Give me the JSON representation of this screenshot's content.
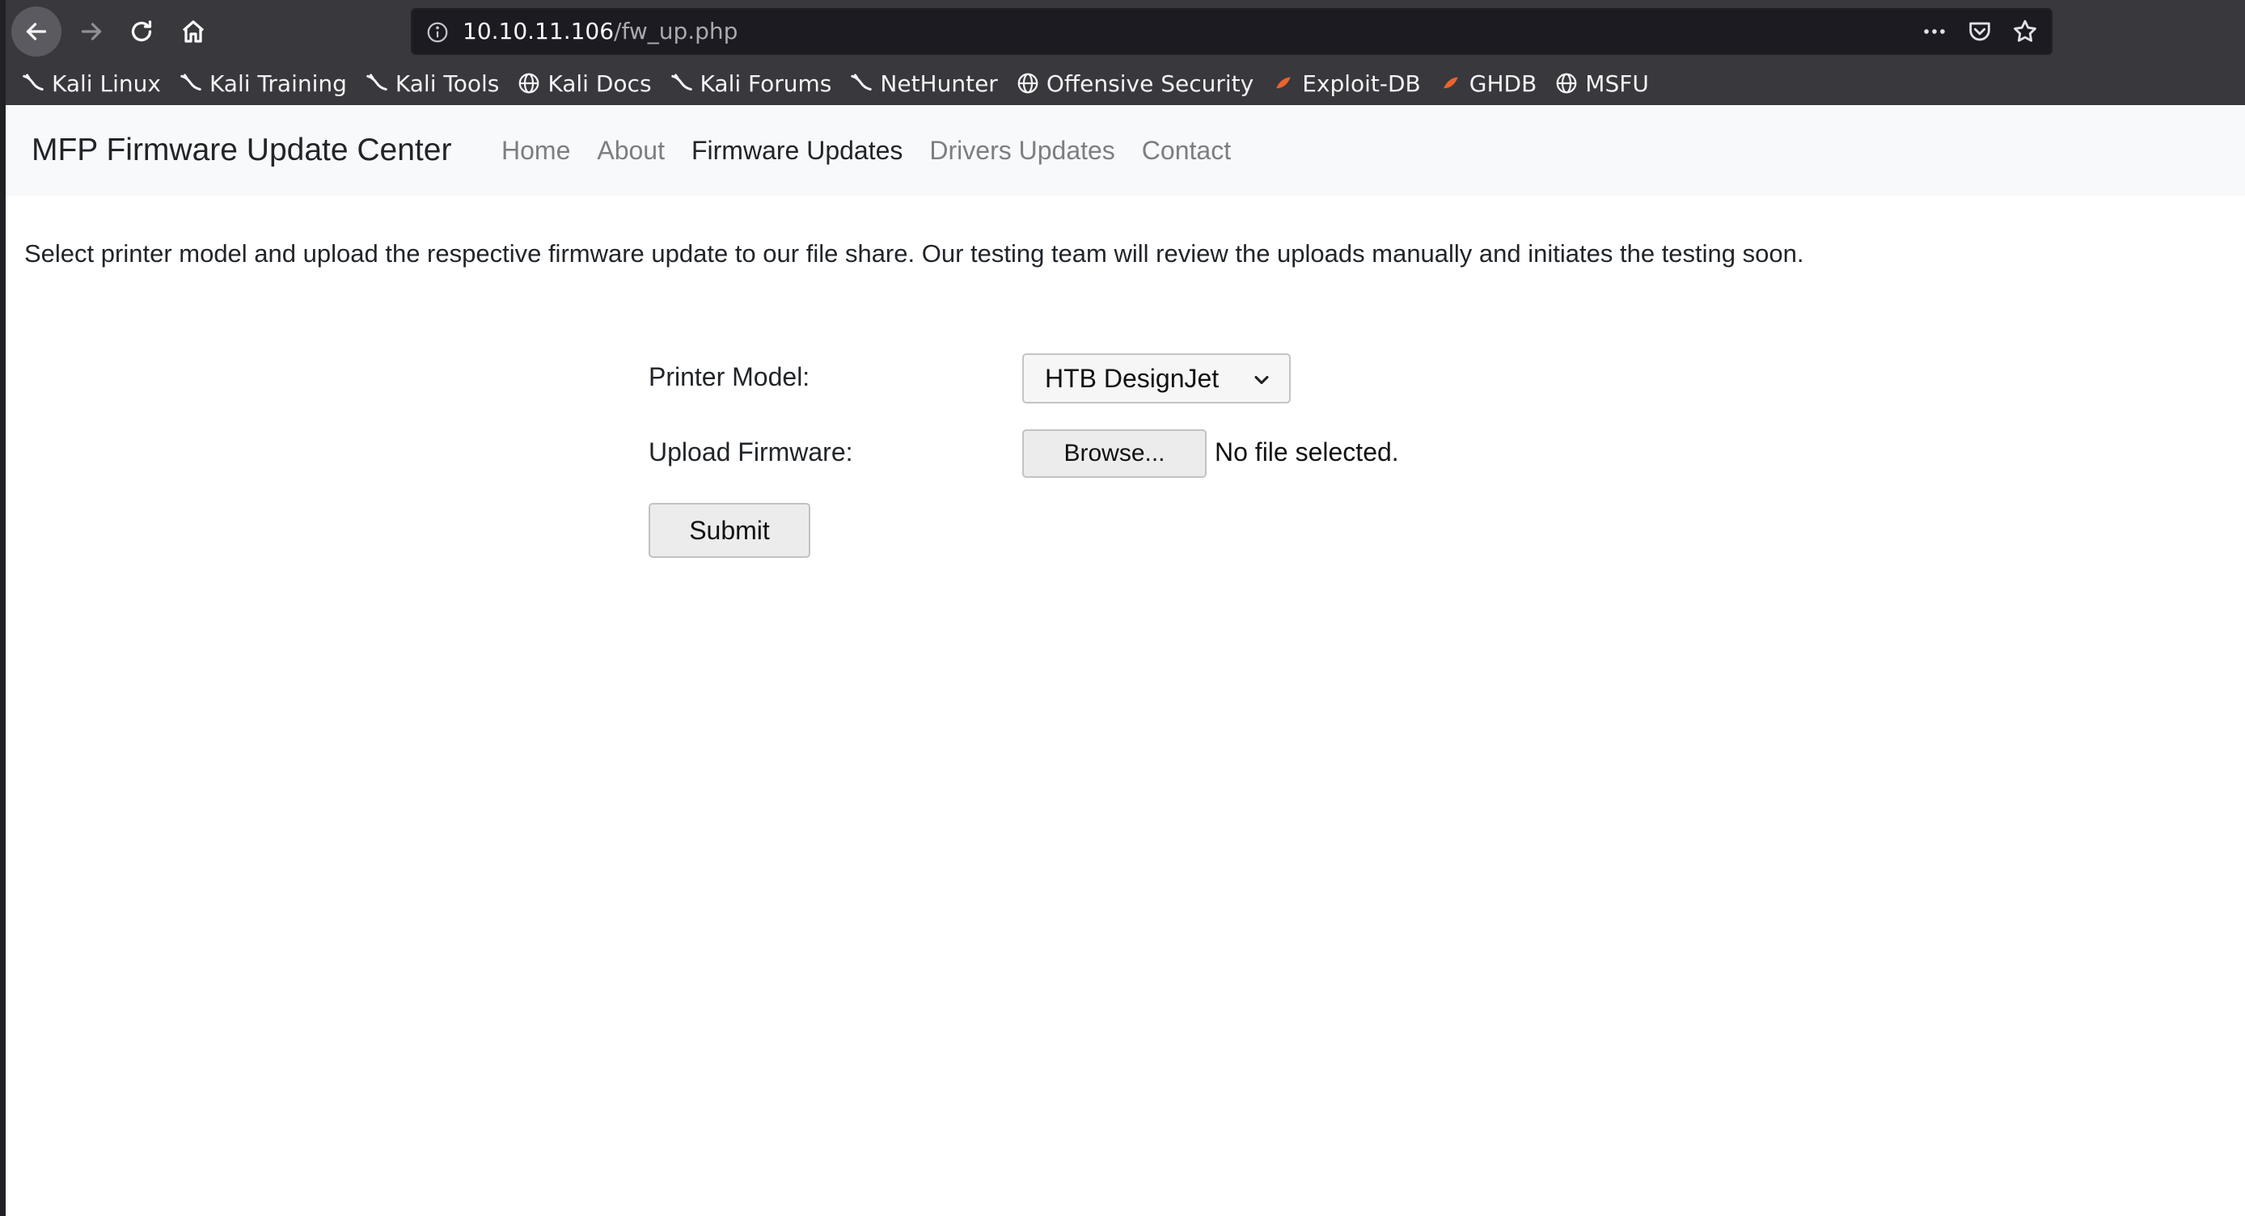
{
  "browser": {
    "url_host": "10.10.11.106",
    "url_path": "/fw_up.php",
    "bookmarks": [
      {
        "label": "Kali Linux",
        "icon": "kali-dragon-icon"
      },
      {
        "label": "Kali Training",
        "icon": "kali-dragon-icon"
      },
      {
        "label": "Kali Tools",
        "icon": "kali-dragon-icon"
      },
      {
        "label": "Kali Docs",
        "icon": "globe-icon"
      },
      {
        "label": "Kali Forums",
        "icon": "kali-dragon-icon"
      },
      {
        "label": "NetHunter",
        "icon": "kali-dragon-icon"
      },
      {
        "label": "Offensive Security",
        "icon": "globe-icon"
      },
      {
        "label": "Exploit-DB",
        "icon": "exploit-db-icon"
      },
      {
        "label": "GHDB",
        "icon": "exploit-db-icon"
      },
      {
        "label": "MSFU",
        "icon": "globe-icon"
      }
    ]
  },
  "navbar": {
    "brand": "MFP Firmware Update Center",
    "links": [
      {
        "label": "Home",
        "active": false
      },
      {
        "label": "About",
        "active": false
      },
      {
        "label": "Firmware Updates",
        "active": true
      },
      {
        "label": "Drivers Updates",
        "active": false
      },
      {
        "label": "Contact",
        "active": false
      }
    ]
  },
  "content": {
    "intro": "Select printer model and upload the respective firmware update to our file share. Our testing team will review the uploads manually and initiates the testing soon.",
    "printer_model_label": "Printer Model:",
    "printer_model_value": "HTB DesignJet",
    "upload_label": "Upload Firmware:",
    "browse_label": "Browse...",
    "file_status": "No file selected.",
    "submit_label": "Submit"
  }
}
